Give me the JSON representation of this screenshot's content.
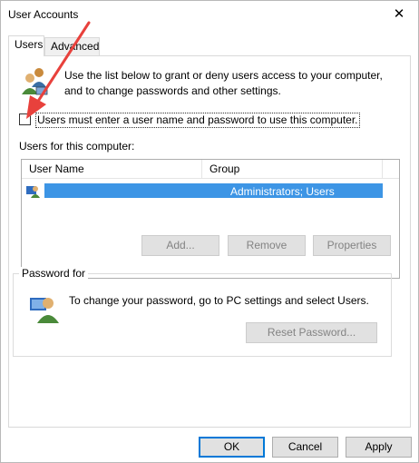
{
  "window": {
    "title": "User Accounts",
    "close_glyph": "✕"
  },
  "tabs": [
    {
      "label": "Users",
      "active": true
    },
    {
      "label": "Advanced",
      "active": false
    }
  ],
  "intro": {
    "text": "Use the list below to grant or deny users access to your computer, and to change passwords and other settings."
  },
  "require_login": {
    "label": "Users must enter a user name and password to use this computer.",
    "checked": false
  },
  "users_list": {
    "label": "Users for this computer:",
    "columns": [
      "User Name",
      "Group"
    ],
    "rows": [
      {
        "user_name": "",
        "group": "Administrators; Users",
        "selected": true
      }
    ]
  },
  "list_buttons": {
    "add": "Add...",
    "remove": "Remove",
    "properties": "Properties"
  },
  "password_group": {
    "title": "Password for",
    "text": "To change your password, go to PC settings and select Users.",
    "reset_button": "Reset Password..."
  },
  "dialog_buttons": {
    "ok": "OK",
    "cancel": "Cancel",
    "apply": "Apply"
  },
  "colors": {
    "selection": "#3d95e5",
    "arrow": "#e8413c",
    "default_button_border": "#0078d7"
  },
  "icons": [
    "users-group-icon",
    "user-row-icon",
    "user-password-icon",
    "close-icon",
    "red-arrow-annotation"
  ]
}
